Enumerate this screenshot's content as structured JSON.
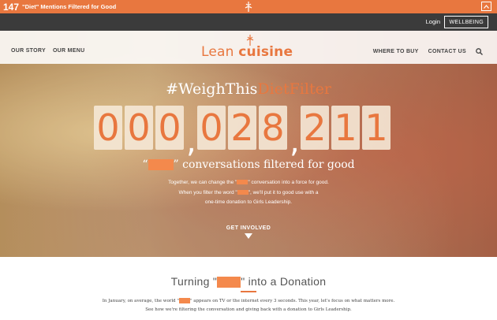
{
  "ticker": {
    "count": "147",
    "message": "\"Diet\" Mentions Filtered for Good"
  },
  "utility": {
    "login": "Login",
    "wellbeing": "WELLBEING"
  },
  "brand": {
    "name_part1": "Lean ",
    "name_part2": "cuisine"
  },
  "nav": {
    "left": [
      "OUR STORY",
      "OUR MENU"
    ],
    "right": [
      "WHERE TO BUY",
      "CONTACT US"
    ]
  },
  "hero": {
    "hashtag_prefix": "#WeighThis",
    "hashtag_accent": "DietFilter",
    "counter_digits": [
      "0",
      "0",
      "0",
      "0",
      "2",
      "8",
      "2",
      "1",
      "1"
    ],
    "filtered_text": "conversations filtered for good",
    "sub_line1a": "Together, we can change the \"",
    "sub_line1b": "\" conversation into a force for good.",
    "sub_line2a": "When you filter the word \"",
    "sub_line2b": "\", we'll put it to good use with a",
    "sub_line3": "one-time donation to Girls Leadership.",
    "cta": "GET INVOLVED"
  },
  "section": {
    "title_a": "Turning \"",
    "title_b": "\" into a Donation",
    "body_line1a": "In January, on average, the world \"",
    "body_line1b": "\" appears on TV or the internet every 3 seconds. This year, let's focus on what matters more.",
    "body_line2": "See how we're filtering the conversation and giving back with a donation to Girls Leadership."
  },
  "colors": {
    "accent": "#e8773f",
    "redaction": "#f4894c",
    "utility_bar": "#3b3b3b"
  },
  "icons": {
    "ticker_logo": "fork-flourish-icon",
    "collapse": "chevron-up-icon",
    "search": "search-icon",
    "cta_arrow": "triangle-down-icon"
  }
}
